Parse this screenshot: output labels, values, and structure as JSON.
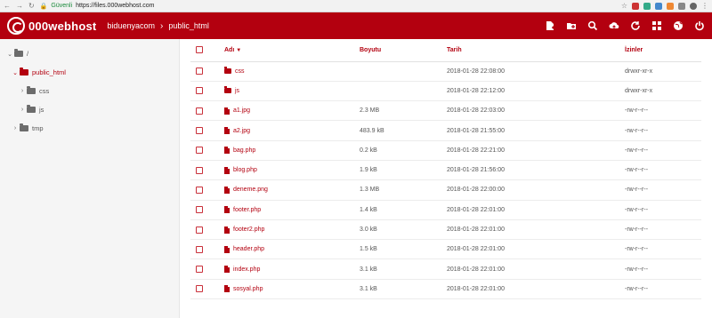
{
  "browser": {
    "secure_label": "Güvenli",
    "url": "https://files.000webhost.com"
  },
  "header": {
    "brand": "000webhost",
    "breadcrumbs": [
      "biduenyacom",
      "public_html"
    ]
  },
  "sidebar": {
    "items": [
      {
        "label": "/",
        "depth": 0,
        "expanded": true,
        "active": false
      },
      {
        "label": "public_html",
        "depth": 1,
        "expanded": true,
        "active": true
      },
      {
        "label": "css",
        "depth": 2,
        "expanded": false,
        "active": false
      },
      {
        "label": "js",
        "depth": 2,
        "expanded": false,
        "active": false
      },
      {
        "label": "tmp",
        "depth": 1,
        "expanded": false,
        "active": false
      }
    ]
  },
  "table": {
    "headers": {
      "name": "Adı",
      "size": "Boyutu",
      "date": "Tarih",
      "perms": "İzinler"
    },
    "sort_indicator": "▼",
    "rows": [
      {
        "type": "folder",
        "name": "css",
        "size": "",
        "date": "2018-01-28 22:08:00",
        "perms": "drwxr-xr-x"
      },
      {
        "type": "folder",
        "name": "js",
        "size": "",
        "date": "2018-01-28 22:12:00",
        "perms": "drwxr-xr-x"
      },
      {
        "type": "file",
        "name": "a1.jpg",
        "size": "2.3 MB",
        "date": "2018-01-28 22:03:00",
        "perms": "-rw-r--r--"
      },
      {
        "type": "file",
        "name": "a2.jpg",
        "size": "483.9 kB",
        "date": "2018-01-28 21:55:00",
        "perms": "-rw-r--r--"
      },
      {
        "type": "file",
        "name": "bag.php",
        "size": "0.2 kB",
        "date": "2018-01-28 22:21:00",
        "perms": "-rw-r--r--"
      },
      {
        "type": "file",
        "name": "blog.php",
        "size": "1.9 kB",
        "date": "2018-01-28 21:56:00",
        "perms": "-rw-r--r--"
      },
      {
        "type": "file",
        "name": "deneme.png",
        "size": "1.3 MB",
        "date": "2018-01-28 22:00:00",
        "perms": "-rw-r--r--"
      },
      {
        "type": "file",
        "name": "footer.php",
        "size": "1.4 kB",
        "date": "2018-01-28 22:01:00",
        "perms": "-rw-r--r--"
      },
      {
        "type": "file",
        "name": "footer2.php",
        "size": "3.0 kB",
        "date": "2018-01-28 22:01:00",
        "perms": "-rw-r--r--"
      },
      {
        "type": "file",
        "name": "header.php",
        "size": "1.5 kB",
        "date": "2018-01-28 22:01:00",
        "perms": "-rw-r--r--"
      },
      {
        "type": "file",
        "name": "index.php",
        "size": "3.1 kB",
        "date": "2018-01-28 22:01:00",
        "perms": "-rw-r--r--"
      },
      {
        "type": "file",
        "name": "sosyal.php",
        "size": "3.1 kB",
        "date": "2018-01-28 22:01:00",
        "perms": "-rw-r--r--"
      }
    ]
  },
  "toolbar_icons": [
    "new-file-icon",
    "new-folder-icon",
    "search-icon",
    "upload-icon",
    "refresh-icon",
    "grid-view-icon",
    "globe-icon",
    "power-icon"
  ],
  "colors": {
    "accent": "#b3000f"
  }
}
